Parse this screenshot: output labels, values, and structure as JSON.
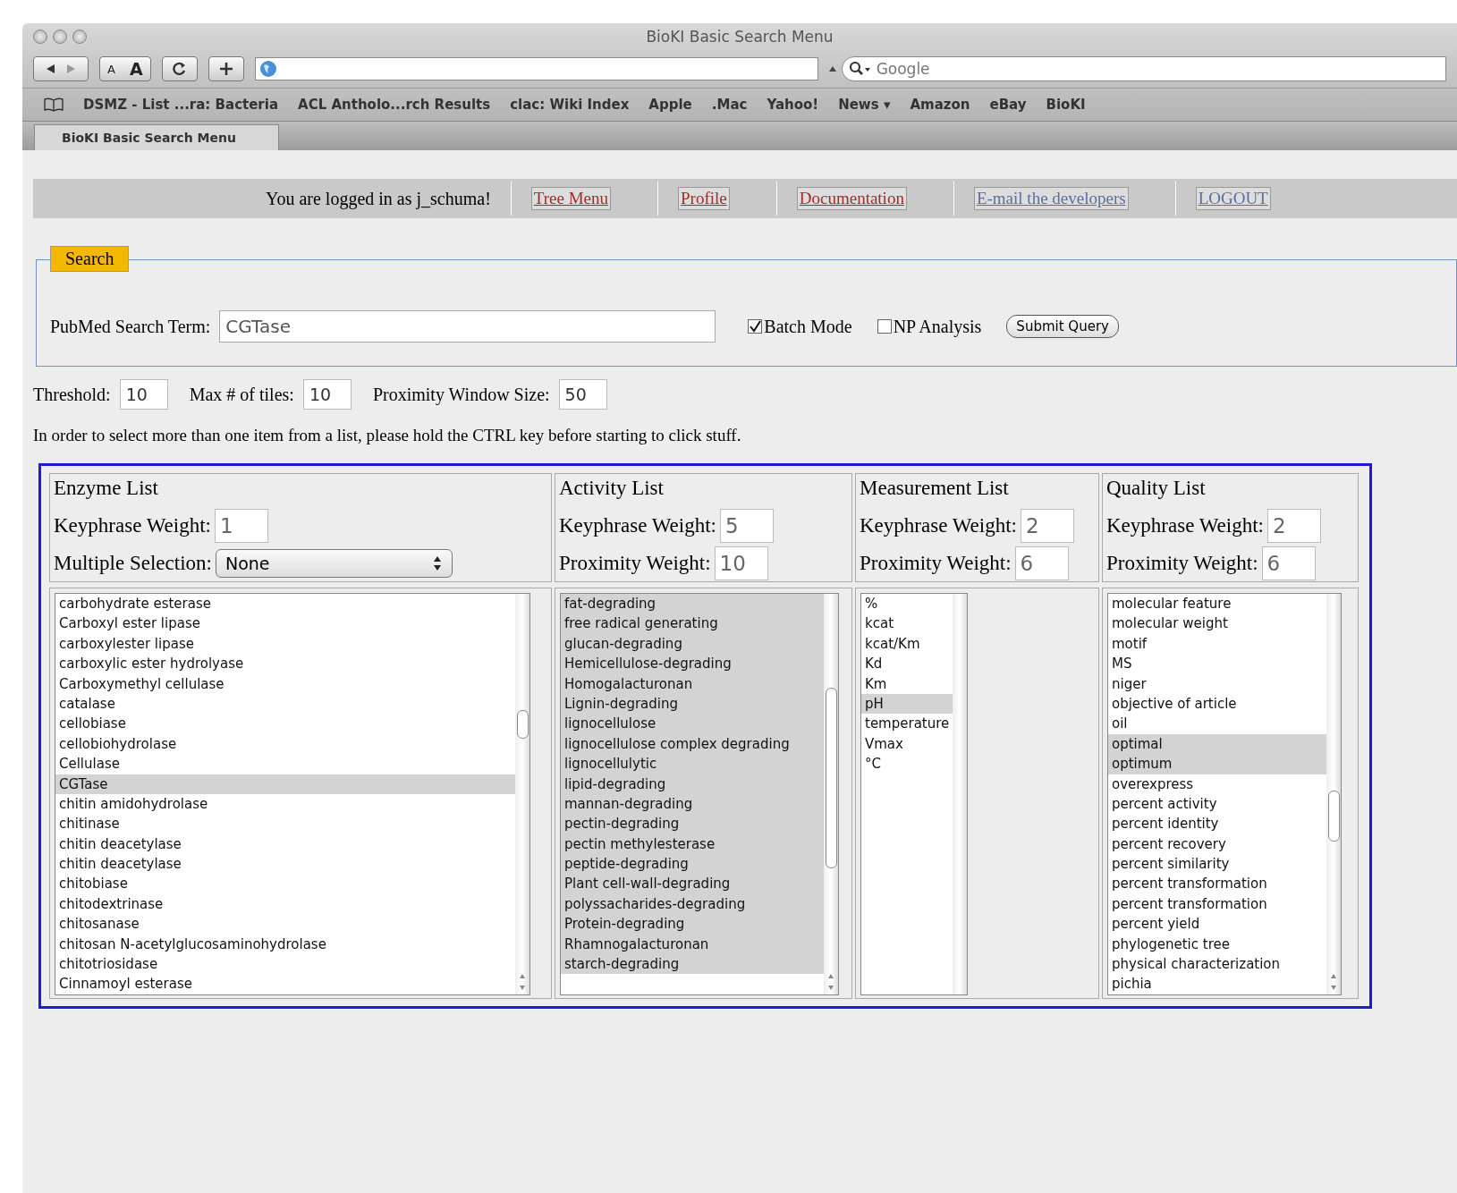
{
  "window": {
    "title": "BioKI Basic Search Menu"
  },
  "toolbar": {
    "text_smaller": "A",
    "text_larger": "A",
    "search_placeholder": "Google"
  },
  "bookmarks": [
    "DSMZ - List ...ra: Bacteria",
    "ACL Antholo...rch Results",
    "clac: Wiki Index",
    "Apple",
    ".Mac",
    "Yahoo!",
    "News ▾",
    "Amazon",
    "eBay",
    "BioKI"
  ],
  "tab": {
    "label": "BioKI Basic Search Menu"
  },
  "nav": {
    "logged_in": "You are logged in as j_schuma!",
    "links": [
      {
        "label": "Tree Menu",
        "visited": false
      },
      {
        "label": "Profile",
        "visited": false
      },
      {
        "label": "Documentation",
        "visited": false
      },
      {
        "label": "E-mail the developers",
        "visited": true
      },
      {
        "label": "LOGOUT",
        "visited": true
      }
    ]
  },
  "search": {
    "legend": "Search",
    "label": "PubMed Search Term:",
    "value": "CGTase",
    "options": [
      {
        "label": "Batch Mode",
        "checked": true
      },
      {
        "label": "NP Analysis",
        "checked": false
      }
    ],
    "submit": "Submit Query"
  },
  "params": [
    {
      "label": "Threshold:",
      "value": "10"
    },
    {
      "label": "Max # of tiles:",
      "value": "10"
    },
    {
      "label": "Proximity Window Size:",
      "value": "50"
    }
  ],
  "instruction": "In order to select more than one item from a list, please hold the CTRL key before starting to click stuff.",
  "lists": [
    {
      "title": "Enzyme List",
      "fields": [
        {
          "kind": "text",
          "label": "Keyphrase Weight:",
          "value": "1"
        },
        {
          "kind": "select",
          "label": "Multiple Selection:",
          "value": "None"
        }
      ],
      "items": [
        {
          "text": "carbohydrate esterase",
          "selected": false
        },
        {
          "text": "Carboxyl ester lipase",
          "selected": false
        },
        {
          "text": "carboxylester lipase",
          "selected": false
        },
        {
          "text": "carboxylic ester hydrolyase",
          "selected": false
        },
        {
          "text": "Carboxymethyl cellulase",
          "selected": false
        },
        {
          "text": "catalase",
          "selected": false
        },
        {
          "text": "cellobiase",
          "selected": false
        },
        {
          "text": "cellobiohydrolase",
          "selected": false
        },
        {
          "text": "Cellulase",
          "selected": false
        },
        {
          "text": "CGTase",
          "selected": true
        },
        {
          "text": "chitin amidohydrolase",
          "selected": false
        },
        {
          "text": "chitinase",
          "selected": false
        },
        {
          "text": "chitin deacetylase",
          "selected": false
        },
        {
          "text": "chitin deacetylase",
          "selected": false
        },
        {
          "text": "chitobiase",
          "selected": false
        },
        {
          "text": "chitodextrinase",
          "selected": false
        },
        {
          "text": "chitosanase",
          "selected": false
        },
        {
          "text": "chitosan N-acetylglucosaminohydrolase",
          "selected": false
        },
        {
          "text": "chitotriosidase",
          "selected": false
        },
        {
          "text": "Cinnamoyl esterase",
          "selected": false
        }
      ]
    },
    {
      "title": "Activity List",
      "fields": [
        {
          "kind": "text",
          "label": "Keyphrase Weight:",
          "value": "5"
        },
        {
          "kind": "text",
          "label": "Proximity Weight:",
          "value": "10"
        }
      ],
      "items": [
        {
          "text": "fat-degrading",
          "selected": true
        },
        {
          "text": "free radical generating",
          "selected": true
        },
        {
          "text": "glucan-degrading",
          "selected": true
        },
        {
          "text": "Hemicellulose-degrading",
          "selected": true
        },
        {
          "text": "Homogalacturonan",
          "selected": true
        },
        {
          "text": "Lignin-degrading",
          "selected": true
        },
        {
          "text": "lignocellulose",
          "selected": true
        },
        {
          "text": "lignocellulose complex degrading",
          "selected": true
        },
        {
          "text": "lignocellulytic",
          "selected": true
        },
        {
          "text": "lipid-degrading",
          "selected": true
        },
        {
          "text": "mannan-degrading",
          "selected": true
        },
        {
          "text": "pectin-degrading",
          "selected": true
        },
        {
          "text": "pectin methylesterase",
          "selected": true
        },
        {
          "text": "peptide-degrading",
          "selected": true
        },
        {
          "text": "Plant cell-wall-degrading",
          "selected": true
        },
        {
          "text": "polyssacharides-degrading",
          "selected": true
        },
        {
          "text": "Protein-degrading",
          "selected": true
        },
        {
          "text": "Rhamnogalacturonan",
          "selected": true
        },
        {
          "text": "starch-degrading",
          "selected": true
        }
      ]
    },
    {
      "title": "Measurement List",
      "fields": [
        {
          "kind": "text",
          "label": "Keyphrase Weight:",
          "value": "2"
        },
        {
          "kind": "text",
          "label": "Proximity Weight:",
          "value": "6"
        }
      ],
      "items": [
        {
          "text": "%",
          "selected": false
        },
        {
          "text": "kcat",
          "selected": false
        },
        {
          "text": "kcat/Km",
          "selected": false
        },
        {
          "text": "Kd",
          "selected": false
        },
        {
          "text": "Km",
          "selected": false
        },
        {
          "text": "pH",
          "selected": true
        },
        {
          "text": "temperature",
          "selected": false
        },
        {
          "text": "Vmax",
          "selected": false
        },
        {
          "text": "°C",
          "selected": false
        }
      ]
    },
    {
      "title": "Quality List",
      "fields": [
        {
          "kind": "text",
          "label": "Keyphrase Weight:",
          "value": "2"
        },
        {
          "kind": "text",
          "label": "Proximity Weight:",
          "value": "6"
        }
      ],
      "items": [
        {
          "text": "molecular feature",
          "selected": false
        },
        {
          "text": "molecular weight",
          "selected": false
        },
        {
          "text": "motif",
          "selected": false
        },
        {
          "text": "MS",
          "selected": false
        },
        {
          "text": "niger",
          "selected": false
        },
        {
          "text": "objective of article",
          "selected": false
        },
        {
          "text": "oil",
          "selected": false
        },
        {
          "text": "optimal",
          "selected": true
        },
        {
          "text": "optimum",
          "selected": true
        },
        {
          "text": "overexpress",
          "selected": false
        },
        {
          "text": "percent activity",
          "selected": false
        },
        {
          "text": "percent identity",
          "selected": false
        },
        {
          "text": "percent recovery",
          "selected": false
        },
        {
          "text": "percent similarity",
          "selected": false
        },
        {
          "text": "percent transformation",
          "selected": false
        },
        {
          "text": "percent transformation",
          "selected": false
        },
        {
          "text": "percent yield",
          "selected": false
        },
        {
          "text": "phylogenetic tree",
          "selected": false
        },
        {
          "text": "physical characterization",
          "selected": false
        },
        {
          "text": "pichia",
          "selected": false
        }
      ]
    }
  ]
}
